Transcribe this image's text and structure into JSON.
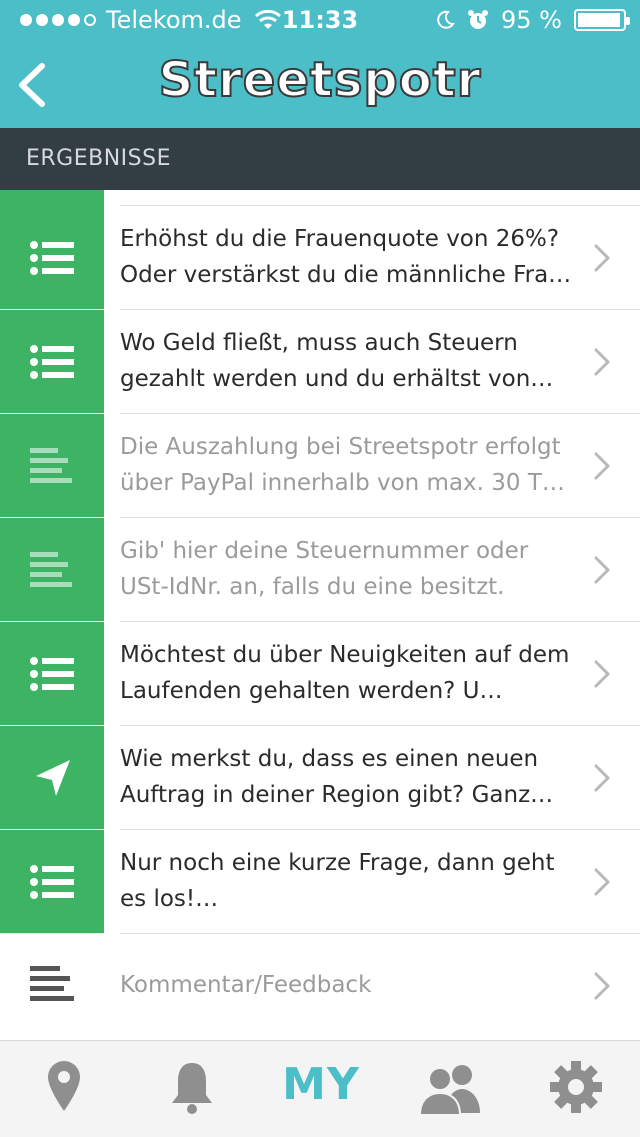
{
  "status_bar": {
    "carrier": "Telekom.de",
    "time": "11:33",
    "battery": "95 %",
    "battery_fraction": 0.95
  },
  "header": {
    "logo": "Streetspotr",
    "back_icon": "chevron-left-icon"
  },
  "section": {
    "title": "ERGEBNISSE"
  },
  "rows": [
    {
      "text": "Erhöhst du die Frauenquote von 26%? Oder verstärkst du die männliche Fra…",
      "icon": "list-icon",
      "dim": false
    },
    {
      "text": "Wo Geld fließt, muss auch Steuern gezahlt werden und du erhältst von…",
      "icon": "list-icon",
      "dim": false
    },
    {
      "text": "Die Auszahlung bei Streetspotr erfolgt über PayPal innerhalb von max. 30 T…",
      "icon": "text-lines-icon",
      "dim": true
    },
    {
      "text": "Gib' hier deine Steuernummer oder USt-IdNr. an, falls du eine besitzt.",
      "icon": "text-lines-icon",
      "dim": true
    },
    {
      "text": "Möchtest du über Neuigkeiten auf dem Laufenden gehalten werden? U…",
      "icon": "list-icon",
      "dim": false
    },
    {
      "text": "Wie merkst du, dass es einen neuen Auftrag in deiner Region gibt? Ganz…",
      "icon": "location-arrow-icon",
      "dim": false
    },
    {
      "text": "Nur noch eine kurze Frage, dann geht es los!…",
      "icon": "list-icon",
      "dim": false
    }
  ],
  "feedback_row": {
    "text": "Kommentar/Feedback",
    "icon": "text-lines-icon"
  },
  "tabbar": {
    "my_label": "MY",
    "tabs": [
      "map-pin-icon",
      "bell-icon",
      "my-tab",
      "users-icon",
      "gear-icon"
    ]
  },
  "colors": {
    "header_bg": "#4bbec8",
    "section_bg": "#323d44",
    "icon_green": "#3cb464",
    "accent": "#4bbec8"
  }
}
